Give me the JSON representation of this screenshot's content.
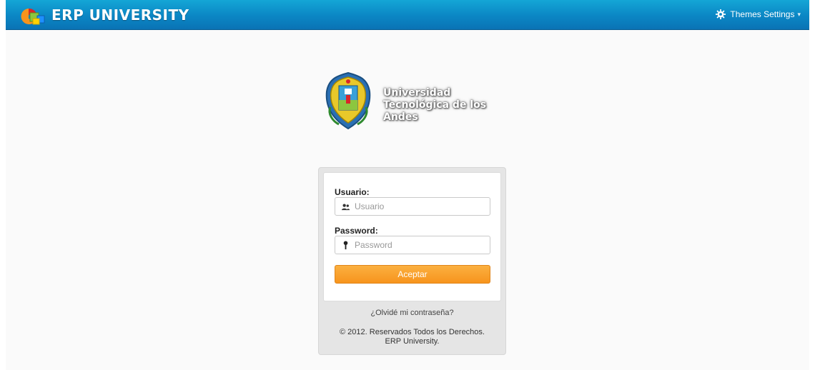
{
  "header": {
    "app_title": "ERP UNIVERSITY",
    "themes_label": "Themes Settings",
    "themes_caret": "▾"
  },
  "institution": {
    "name_line1": "Universidad",
    "name_line2": "Tecnológica de los Andes"
  },
  "login": {
    "user_label": "Usuario:",
    "user_placeholder": "Usuario",
    "user_value": "",
    "password_label": "Password:",
    "password_placeholder": "Password",
    "password_value": "",
    "submit_label": "Aceptar",
    "forgot_label": "¿Olvidé mi contraseña?"
  },
  "footer": {
    "copyright_line1": "© 2012. Reservados Todos los Derechos.",
    "copyright_line2": "ERP University."
  },
  "icons": {
    "brand": "cubes-logo-icon",
    "themes": "gear-icon",
    "user_field": "users-icon",
    "password_field": "key-icon"
  },
  "colors": {
    "topbar": "#0b86c4",
    "button": "#f7941d",
    "panel": "#e5e5e5"
  }
}
